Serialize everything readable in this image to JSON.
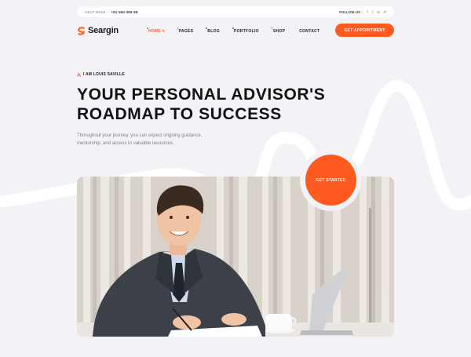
{
  "topbar": {
    "help_label": "HELP DESK :",
    "help_number": "+91 560 058 88",
    "follow_label": "FOLLOW US :",
    "socials": [
      {
        "icon": "twitter-icon",
        "glyph": "𝕥"
      },
      {
        "icon": "facebook-icon",
        "glyph": "f"
      },
      {
        "icon": "linkedin-icon",
        "glyph": "in"
      },
      {
        "icon": "pinterest-icon",
        "glyph": "P"
      }
    ]
  },
  "nav": {
    "brand": "Seargin",
    "items": [
      {
        "label": "HOME",
        "active": true
      },
      {
        "label": "PAGES",
        "active": false
      },
      {
        "label": "BLOG",
        "active": false
      },
      {
        "label": "PORTFOLIO",
        "active": false
      },
      {
        "label": "SHOP",
        "active": false
      },
      {
        "label": "CONTACT",
        "active": false
      }
    ],
    "cta": "GET APPOINTMENT"
  },
  "hero": {
    "eyebrow": "I AM LOUIS SAVILLE",
    "headline_line1": "YOUR PERSONAL ADVISOR'S",
    "headline_line2": "ROADMAP TO SUCCESS",
    "subtext": "Throughout your journey, you can expect ongoing guidance, mentorship, and access to valuable resources.",
    "start_button": "GET STARTED"
  },
  "colors": {
    "accent": "#ff5a1f",
    "background": "#f3f3f7",
    "text": "#141414",
    "muted": "#7a7f92"
  }
}
